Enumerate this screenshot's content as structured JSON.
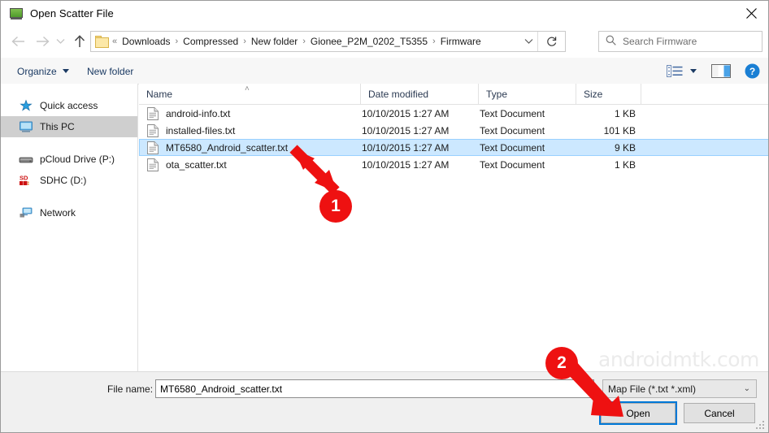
{
  "window": {
    "title": "Open Scatter File",
    "title_icon": "scatter-file-icon",
    "close_label": "✕"
  },
  "nav": {
    "back_icon": "arrow-left-icon",
    "forward_icon": "arrow-right-icon",
    "recent_icon": "chevron-down-icon",
    "up_icon": "arrow-up-icon",
    "refresh_icon": "refresh-icon",
    "dropdown_icon": "chevron-down-icon"
  },
  "address": {
    "folder_icon": "folder-icon",
    "separator": "›",
    "prefix": "«",
    "crumbs": [
      "Downloads",
      "Compressed",
      "New folder",
      "Gionee_P2M_0202_T5355",
      "Firmware"
    ]
  },
  "search": {
    "icon": "search-icon",
    "placeholder": "Search Firmware",
    "value": ""
  },
  "commandbar": {
    "organize_label": "Organize",
    "new_folder_label": "New folder",
    "view_icon": "view-options-icon",
    "pane_icon": "preview-pane-icon",
    "help_icon": "help-icon"
  },
  "sidebar": {
    "items": [
      {
        "label": "Quick access",
        "icon": "star-icon",
        "selected": false
      },
      {
        "label": "This PC",
        "icon": "monitor-icon",
        "selected": true
      },
      {
        "label": "pCloud Drive (P:)",
        "icon": "drive-icon",
        "selected": false
      },
      {
        "label": "SDHC (D:)",
        "icon": "sd-card-icon",
        "selected": false
      },
      {
        "label": "Network",
        "icon": "network-icon",
        "selected": false
      }
    ]
  },
  "filelist": {
    "columns": [
      "Name",
      "Date modified",
      "Type",
      "Size"
    ],
    "sort_column": "Name",
    "sort_direction": "ascending",
    "sort_caret": "˄",
    "rows": [
      {
        "name": "android-info.txt",
        "date": "10/10/2015 1:27 AM",
        "type": "Text Document",
        "size": "1 KB",
        "icon": "text-document-icon",
        "selected": false
      },
      {
        "name": "installed-files.txt",
        "date": "10/10/2015 1:27 AM",
        "type": "Text Document",
        "size": "101 KB",
        "icon": "text-document-icon",
        "selected": false
      },
      {
        "name": "MT6580_Android_scatter.txt",
        "date": "10/10/2015 1:27 AM",
        "type": "Text Document",
        "size": "9 KB",
        "icon": "text-document-icon",
        "selected": true
      },
      {
        "name": "ota_scatter.txt",
        "date": "10/10/2015 1:27 AM",
        "type": "Text Document",
        "size": "1 KB",
        "icon": "text-document-icon",
        "selected": false
      }
    ]
  },
  "footer": {
    "filename_label": "File name:",
    "filename_value": "MT6580_Android_scatter.txt",
    "filter_value": "Map File (*.txt *.xml)",
    "filter_arrow": "⌄",
    "open_label": "Open",
    "cancel_label": "Cancel"
  },
  "watermark": {
    "text": "androidmtk.com"
  },
  "annotations": {
    "color": "#ee1111",
    "markers": [
      {
        "label": "1",
        "target": "selected-file-row"
      },
      {
        "label": "2",
        "target": "open-button"
      }
    ]
  }
}
